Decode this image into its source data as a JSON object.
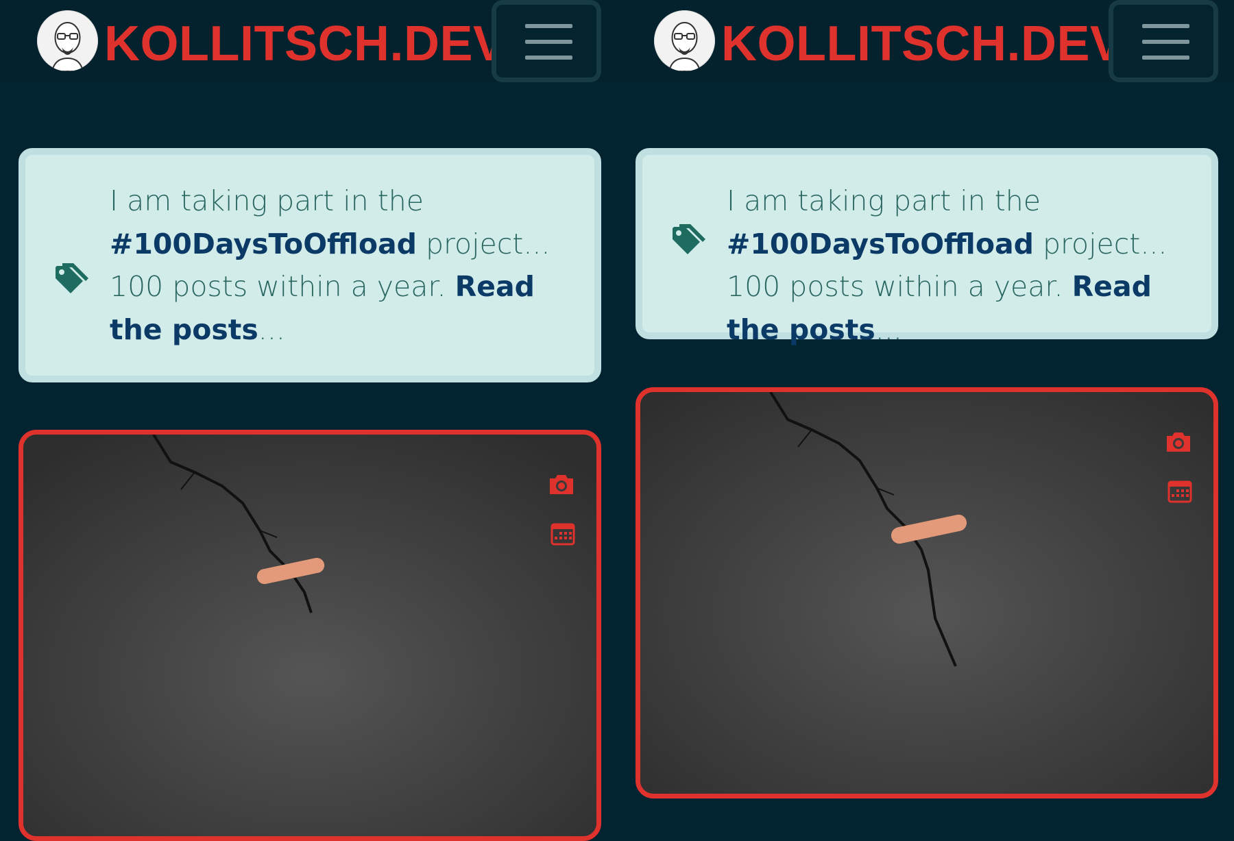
{
  "header": {
    "site_title": "KOLLITSCH.DEV",
    "avatar_icon": "avatar-illustration",
    "menu_icon": "hamburger-icon"
  },
  "notice": {
    "intro": "I am taking part in the ",
    "hashtag": "#100DaysToOffload",
    "middle": " project... 100 posts within a year. ",
    "link": "Read the posts",
    "ellipsis": "...",
    "icon": "tag-icon"
  },
  "card": {
    "camera_icon": "camera-icon",
    "calendar_icon": "calendar-icon"
  },
  "colors": {
    "background": "#022431",
    "accent": "#e0322d",
    "notice_bg": "#d2ecea",
    "link": "#0c3a66"
  }
}
